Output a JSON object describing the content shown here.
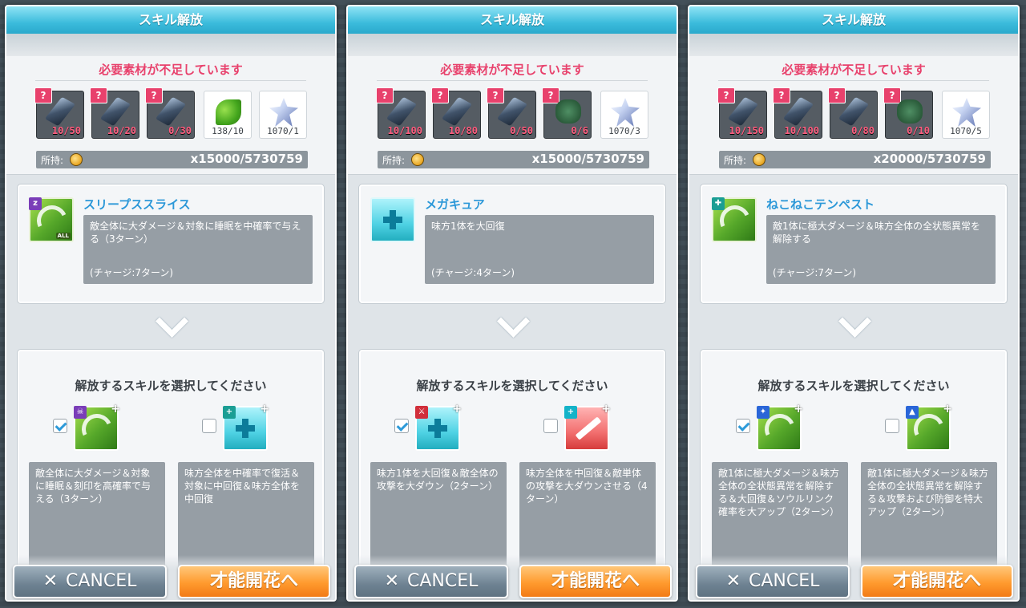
{
  "panels": [
    {
      "header": "スキル解放",
      "warning": "必要素材が不足しています",
      "materials": [
        {
          "icon": "dark-crystal-small-icon",
          "count": "10/50",
          "missing": true
        },
        {
          "icon": "dark-crystal-medium-icon",
          "count": "10/20",
          "missing": true
        },
        {
          "icon": "dark-crystal-large-icon",
          "count": "0/30",
          "missing": true
        },
        {
          "icon": "green-leaf-icon",
          "count": "138/10",
          "missing": false
        },
        {
          "icon": "ice-crystal-icon",
          "count": "1070/1",
          "missing": false
        }
      ],
      "owned_label": "所持:",
      "owned_value": "x15000/5730759",
      "current_skill": {
        "name": "スリープススライス",
        "desc": "敵全体に大ダメージ＆対象に睡眠を中確率で与える（3ターン）",
        "charge": "(チャージ:7ターン)",
        "icon": "sleep-slash-icon"
      },
      "select_title": "解放するスキルを選択してください",
      "options": [
        {
          "checked": true,
          "icon": "poison-slash-icon",
          "desc": "敵全体に大ダメージ＆対象に睡眠＆刻印を高確率で与える（3ターン）"
        },
        {
          "checked": false,
          "icon": "revive-heal-icon",
          "desc": "味方全体を中確率で復活＆対象に中回復＆味方全体を中回復"
        }
      ],
      "cancel_label": "CANCEL",
      "bloom_label": "才能開花へ"
    },
    {
      "header": "スキル解放",
      "warning": "必要素材が不足しています",
      "materials": [
        {
          "icon": "dark-crystal-small-icon",
          "count": "10/100",
          "missing": true
        },
        {
          "icon": "dark-crystal-medium-icon",
          "count": "10/80",
          "missing": true
        },
        {
          "icon": "dark-crystal-large-icon",
          "count": "0/50",
          "missing": true
        },
        {
          "icon": "herb-icon",
          "count": "0/6",
          "missing": true
        },
        {
          "icon": "ice-crystal-icon",
          "count": "1070/3",
          "missing": false
        }
      ],
      "owned_label": "所持:",
      "owned_value": "x15000/5730759",
      "current_skill": {
        "name": "メガキュア",
        "desc": "味方1体を大回復",
        "charge": "(チャージ:4ターン)",
        "icon": "heal-plus-icon"
      },
      "select_title": "解放するスキルを選択してください",
      "options": [
        {
          "checked": true,
          "icon": "heal-attack-down-icon",
          "desc": "味方1体を大回復＆敵全体の攻撃を大ダウン（2ターン）"
        },
        {
          "checked": false,
          "icon": "sword-down-icon",
          "desc": "味方全体を中回復＆敵単体の攻撃を大ダウンさせる（4ターン）"
        }
      ],
      "cancel_label": "CANCEL",
      "bloom_label": "才能開花へ"
    },
    {
      "header": "スキル解放",
      "warning": "必要素材が不足しています",
      "materials": [
        {
          "icon": "dark-crystal-small-icon",
          "count": "10/150",
          "missing": true
        },
        {
          "icon": "dark-crystal-medium-icon",
          "count": "10/100",
          "missing": true
        },
        {
          "icon": "dark-crystal-large-icon",
          "count": "0/80",
          "missing": true
        },
        {
          "icon": "herb-icon",
          "count": "0/10",
          "missing": true
        },
        {
          "icon": "ice-crystal-icon",
          "count": "1070/5",
          "missing": false
        }
      ],
      "owned_label": "所持:",
      "owned_value": "x20000/5730759",
      "current_skill": {
        "name": "ねこねこテンペスト",
        "desc": "敵1体に極大ダメージ＆味方全体の全状態異常を解除する",
        "charge": "(チャージ:7ターン)",
        "icon": "wind-tempest-icon"
      },
      "select_title": "解放するスキルを選択してください",
      "options": [
        {
          "checked": true,
          "icon": "wind-soul-icon",
          "desc": "敵1体に極大ダメージ＆味方全体の全状態異常を解除する＆大回復＆ソウルリンク確率を大アップ（2ターン）"
        },
        {
          "checked": false,
          "icon": "wind-buff-icon",
          "desc": "敵1体に極大ダメージ＆味方全体の全状態異常を解除する＆攻撃および防御を特大アップ（2ターン）"
        }
      ],
      "cancel_label": "CANCEL",
      "bloom_label": "才能開花へ"
    }
  ]
}
